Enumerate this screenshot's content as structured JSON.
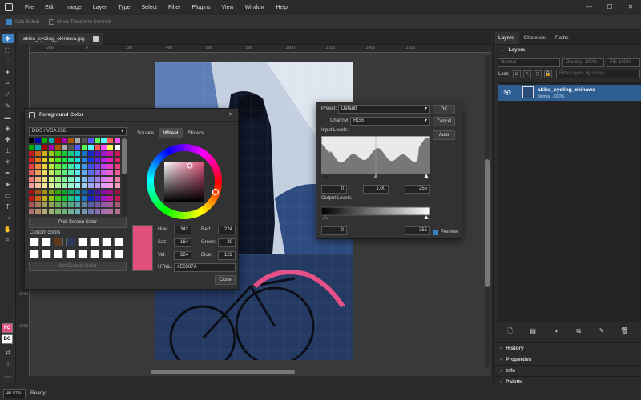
{
  "menu": [
    "File",
    "Edit",
    "Image",
    "Layer",
    "Type",
    "Select",
    "Filter",
    "Plugins",
    "View",
    "Window",
    "Help"
  ],
  "window_controls": [
    "—",
    "☐",
    "✕"
  ],
  "options": {
    "auto_select": "Auto-Select",
    "show_transform": "Show Transform Controls"
  },
  "document_tab": "akiko_cycling_okinawa.jpg",
  "rulers": {
    "h": [
      "-200",
      "0",
      "200",
      "400",
      "600",
      "800",
      "1000",
      "1200",
      "1400",
      "1600"
    ],
    "v": [
      "1400",
      "1600"
    ]
  },
  "status": {
    "zoom": "40.97%",
    "text": "Ready"
  },
  "tools_fgbg": {
    "fg": "FG",
    "bg": "BG"
  },
  "panel": {
    "tabs": [
      "Layers",
      "Channels",
      "Paths"
    ],
    "layers_title": "Layers",
    "blend_mode": "Normal",
    "opacity": "Opacity: 100%",
    "fill": "Fill: 100%",
    "lock_label": "Lock",
    "search_placeholder": "Filter layers by name",
    "layer": {
      "name": "akiko_cycling_okinawa",
      "meta": "Normal · 100%"
    },
    "collapsed": [
      "History",
      "Properties",
      "Info",
      "Palette"
    ]
  },
  "fg_dialog": {
    "title": "Foreground Color",
    "palette": "DOS / VGA 256",
    "tabs": [
      "Square",
      "Wheel",
      "Sliders"
    ],
    "pick_screen": "Pick Screen Color",
    "custom_colors": "Custom colors",
    "set_custom": "Set Custom Color",
    "hue_l": "Hue:",
    "hue": "342",
    "sat_l": "Sat:",
    "sat": "164",
    "val_l": "Val:",
    "val": "224",
    "red_l": "Red:",
    "red": "224",
    "green_l": "Green:",
    "green": "80",
    "blue_l": "Blue:",
    "blue": "122",
    "html_l": "HTML:",
    "html": "#E0507A",
    "close": "Close",
    "preview_color": "#E0507A",
    "accent_tab": "#4a4a4a"
  },
  "levels": {
    "preset_l": "Preset:",
    "preset": "Default",
    "channel_l": "Channel:",
    "channel": "RGB",
    "input_l": "Input Levels:",
    "in_black": "0",
    "in_gamma": "1.00",
    "in_white": "255",
    "output_l": "Output Levels:",
    "out_black": "0",
    "out_white": "255",
    "ok": "OK",
    "cancel": "Cancel",
    "auto": "Auto",
    "preview": "Preview"
  },
  "colors": {
    "accent": "#3b82c4",
    "layer_selected": "#2f5e93",
    "fg": "#E0507A",
    "bg": "#FFFFFF"
  }
}
